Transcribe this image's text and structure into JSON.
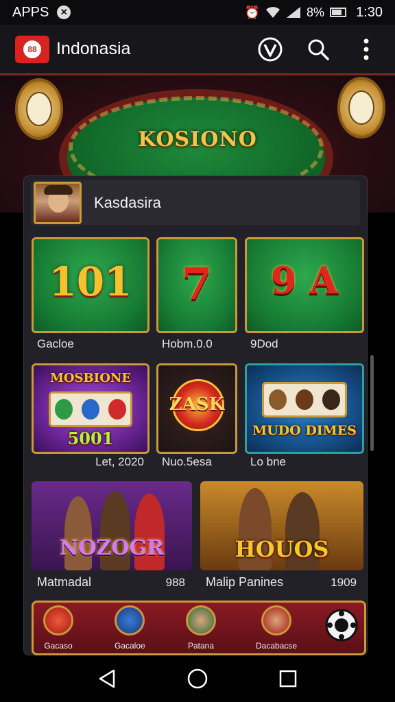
{
  "status_bar": {
    "left_text": "APPS",
    "battery_percent": "8%",
    "time": "1:30"
  },
  "app_bar": {
    "logo_text": "88",
    "title": "Indonasia"
  },
  "hero": {
    "title": "KOSIONO"
  },
  "profile": {
    "name": "Kasdasira"
  },
  "row1": [
    {
      "art_text": "101",
      "label": "Gacloe",
      "value": ""
    },
    {
      "art_text": "7",
      "label": "Hobm.0.0",
      "value": ""
    },
    {
      "art_text": "9 A",
      "label": "9Dod",
      "value": ""
    }
  ],
  "row2": [
    {
      "art_title": "MOSBIONE",
      "art_sub": "5001",
      "label": "Let, 2020",
      "value": ""
    },
    {
      "art_title": "ZASK",
      "art_sub": "",
      "label": "Nuo.5esa",
      "value": ""
    },
    {
      "art_title": "MUDO DIMES",
      "art_sub": "",
      "label": "Lo bne",
      "value": ""
    }
  ],
  "row3": [
    {
      "art_title": "NOZOGR",
      "label": "Matmadal",
      "value": "988"
    },
    {
      "art_title": "HOUOS",
      "label": "Malip Panines",
      "value": "1909"
    }
  ],
  "strip": [
    {
      "label": "Gacaso"
    },
    {
      "label": "Gacaloe"
    },
    {
      "label": "Patana"
    },
    {
      "label": "Dacabacse"
    }
  ],
  "colors": {
    "accent": "#c9993b",
    "brand_red": "#d8231f",
    "panel": "#222127"
  }
}
